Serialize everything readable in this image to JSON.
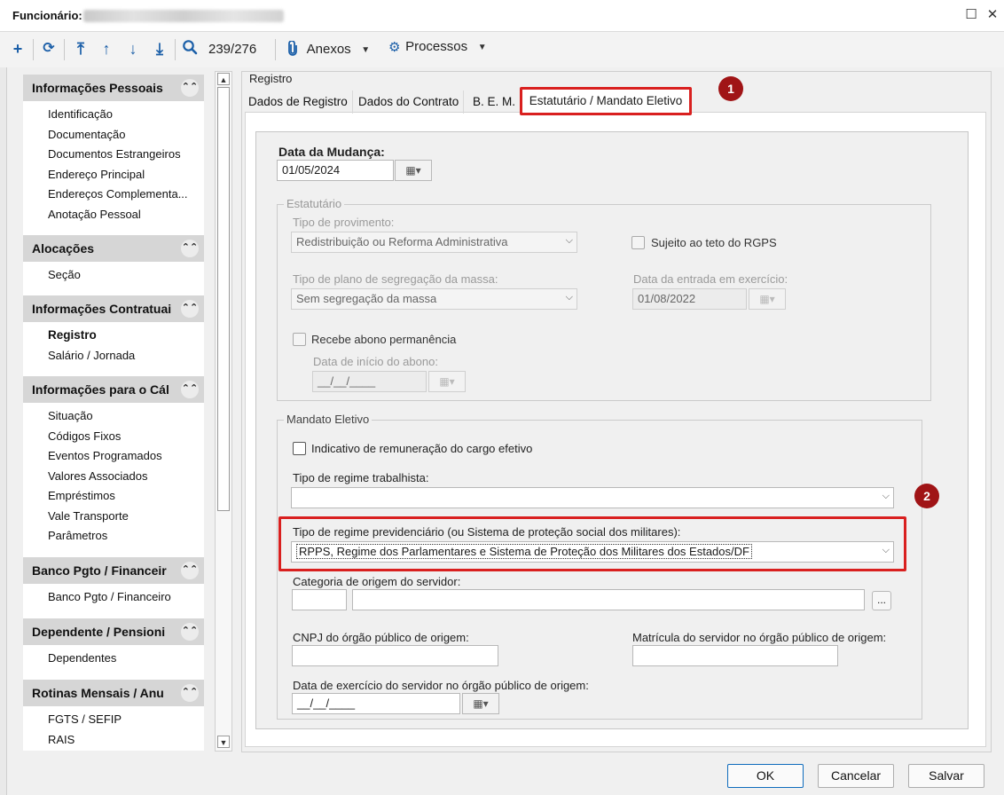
{
  "window": {
    "title": "Funcionário:",
    "maximize_icon": "maximize-icon",
    "close_icon": "close-icon"
  },
  "toolbar": {
    "record_counter": "239/276",
    "anexos_label": "Anexos",
    "processos_label": "Processos"
  },
  "sidebar": {
    "sections": [
      {
        "title": "Informações Pessoais",
        "items": [
          "Identificação",
          "Documentação",
          "Documentos Estrangeiros",
          "Endereço Principal",
          "Endereços Complementa...",
          "Anotação Pessoal"
        ]
      },
      {
        "title": "Alocações",
        "items": [
          "Seção"
        ]
      },
      {
        "title": "Informações Contratuai",
        "items": [
          "Registro",
          "Salário / Jornada"
        ]
      },
      {
        "title": "Informações para o Cál",
        "items": [
          "Situação",
          "Códigos Fixos",
          "Eventos Programados",
          "Valores Associados",
          "Empréstimos",
          "Vale Transporte",
          "Parâmetros"
        ]
      },
      {
        "title": "Banco Pgto / Financeir",
        "items": [
          "Banco Pgto / Financeiro"
        ]
      },
      {
        "title": "Dependente / Pensioni",
        "items": [
          "Dependentes"
        ]
      },
      {
        "title": "Rotinas Mensais / Anu",
        "items": [
          "FGTS / SEFIP",
          "RAIS"
        ]
      }
    ],
    "active_item": "Registro"
  },
  "main": {
    "group_label": "Registro",
    "tabs": [
      "Dados de Registro",
      "Dados do Contrato",
      "B. E. M.",
      "Estatutário / Mandato Eletivo"
    ],
    "active_tab": "Estatutário / Mandato Eletivo",
    "data_mudanca": {
      "label": "Data da Mudança:",
      "value": "01/05/2024"
    },
    "estatutario": {
      "legend": "Estatutário",
      "tipo_provimento": {
        "label": "Tipo de provimento:",
        "value": "Redistribuição ou Reforma Administrativa"
      },
      "sujeito_teto": {
        "label": "Sujeito ao teto do RGPS",
        "checked": false
      },
      "tipo_plano": {
        "label": "Tipo de plano de segregação da massa:",
        "value": "Sem segregação da massa"
      },
      "data_entrada": {
        "label": "Data da entrada em exercício:",
        "value": "01/08/2022"
      },
      "recebe_abono": {
        "label": "Recebe abono permanência",
        "checked": false
      },
      "data_inicio_abono": {
        "label": "Data de início do abono:",
        "value": "__/__/____"
      }
    },
    "mandato": {
      "legend": "Mandato Eletivo",
      "indicativo": {
        "label": "Indicativo de remuneração do cargo efetivo",
        "checked": false
      },
      "tipo_regime_trabalhista": {
        "label": "Tipo de regime trabalhista:",
        "value": ""
      },
      "tipo_regime_previdenciario": {
        "label": "Tipo de regime previdenciário (ou Sistema de proteção social dos militares):",
        "value": "RPPS, Regime dos Parlamentares e Sistema de Proteção dos Militares dos Estados/DF"
      },
      "categoria_origem": {
        "label": "Categoria de origem do servidor:",
        "code": "",
        "description": "",
        "lookup_label": "..."
      },
      "cnpj_origem": {
        "label": "CNPJ do órgão público de origem:",
        "value": ""
      },
      "matricula_origem": {
        "label": "Matrícula do servidor no órgão público de origem:",
        "value": ""
      },
      "data_exercicio_origem": {
        "label": "Data de exercício do servidor no órgão público de origem:",
        "value": "__/__/____"
      }
    }
  },
  "callouts": [
    "1",
    "2"
  ],
  "buttons": {
    "ok": "OK",
    "cancel": "Cancelar",
    "save": "Salvar"
  },
  "colors": {
    "highlight": "#d9201f",
    "callout": "#a01416",
    "toolbar_icon": "#1b5fa8"
  }
}
